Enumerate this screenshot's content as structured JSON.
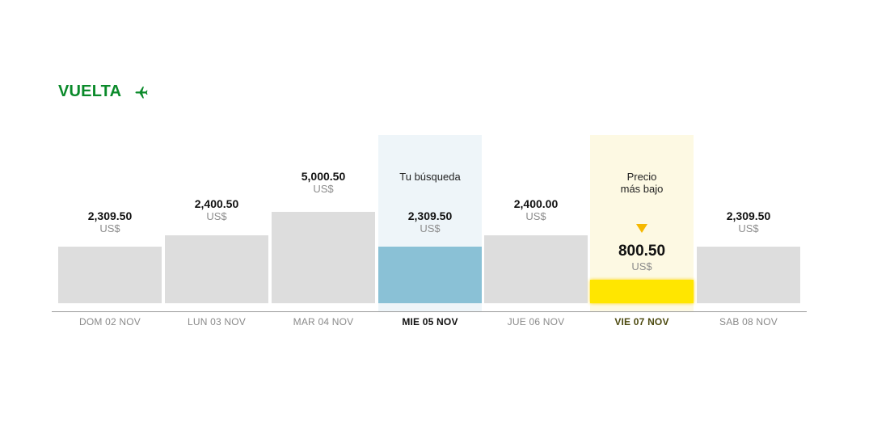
{
  "header": {
    "title": "VUELTA",
    "icon": "plane-return-icon",
    "color": "#0a8a2a"
  },
  "days": [
    {
      "date": "DOM 02 NOV",
      "price": "2,309.50",
      "currency": "US$"
    },
    {
      "date": "LUN 03 NOV",
      "price": "2,400.50",
      "currency": "US$"
    },
    {
      "date": "MAR 04 NOV",
      "price": "5,000.50",
      "currency": "US$"
    },
    {
      "date": "MIE 05 NOV",
      "price": "2,309.50",
      "currency": "US$",
      "note": "Tu búsqueda"
    },
    {
      "date": "JUE 06 NOV",
      "price": "2,400.00",
      "currency": "US$"
    },
    {
      "date": "VIE 07 NOV",
      "price": "800.50",
      "currency": "US$",
      "note_line1": "Precio",
      "note_line2": "más bajo"
    },
    {
      "date": "SAB 08 NOV",
      "price": "2,309.50",
      "currency": "US$"
    }
  ],
  "colors": {
    "bar_default": "#dddddd",
    "bar_search": "#8ac1d6",
    "bar_lowest": "#ffe600",
    "highlight_search": "#eef5f9",
    "highlight_lowest": "#fdf9e3"
  }
}
